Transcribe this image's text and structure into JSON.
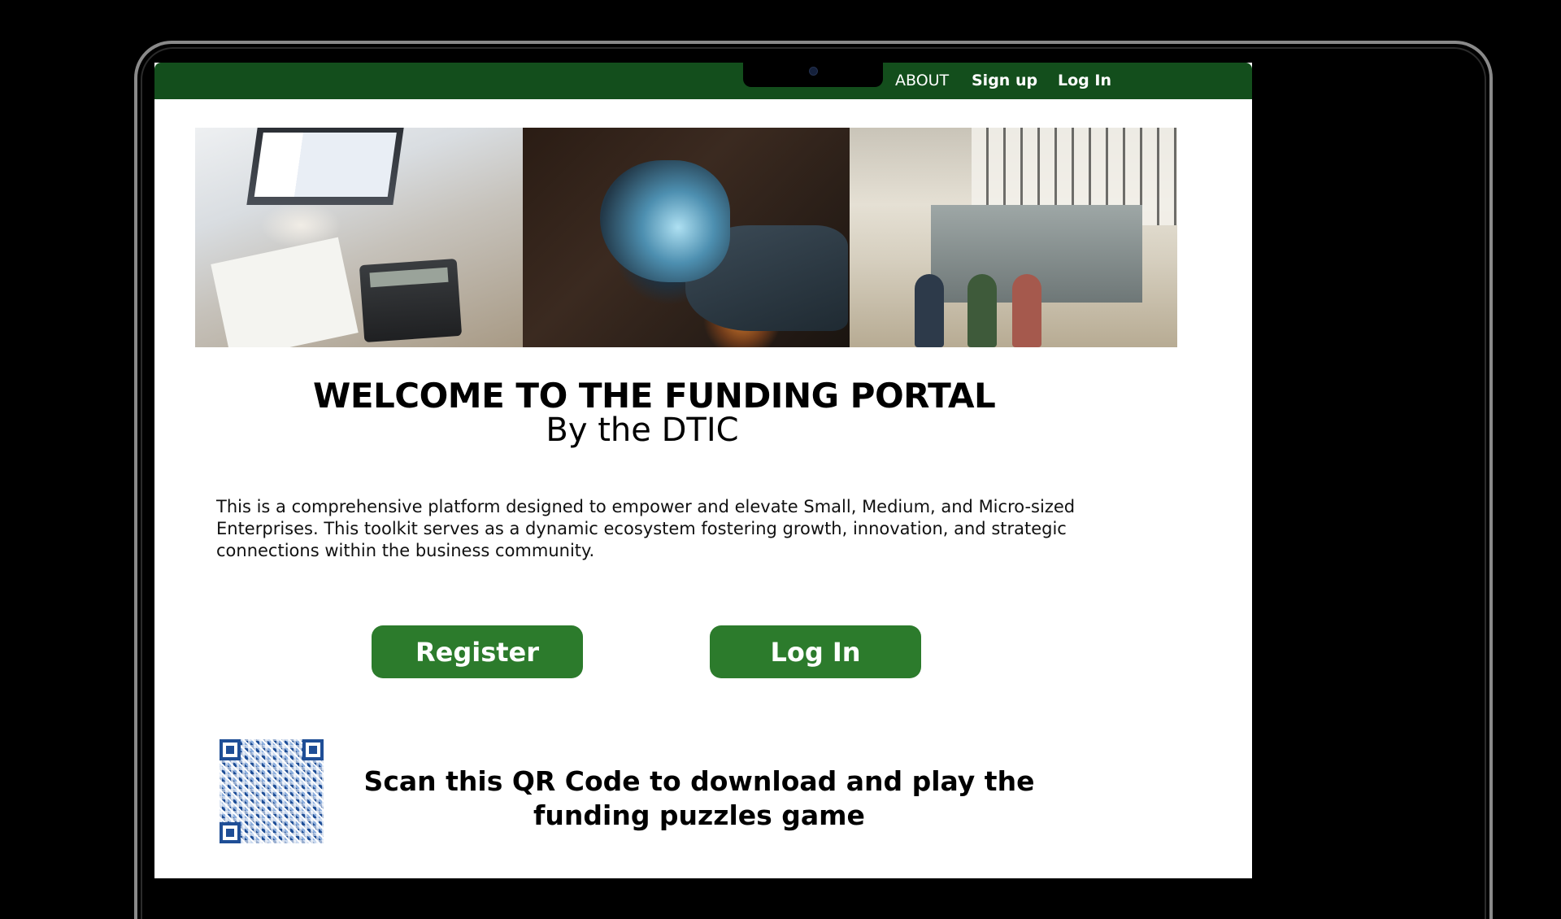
{
  "nav": {
    "about": "ABOUT",
    "signup": "Sign up",
    "login": "Log In"
  },
  "hero": {
    "title": "WELCOME TO THE FUNDING PORTAL",
    "subtitle": "By the DTIC"
  },
  "description": "This is a comprehensive platform designed to empower and elevate Small, Medium, and Micro-sized Enterprises. This toolkit serves as a dynamic ecosystem fostering growth, innovation, and strategic connections within the business community.",
  "buttons": {
    "register": "Register",
    "login": "Log In"
  },
  "qr": {
    "text": "Scan this QR Code to download and play the funding puzzles game"
  },
  "colors": {
    "navbar": "#134e1c",
    "button": "#2c7b2c",
    "qr": "#1f4e96"
  },
  "icons": {
    "camera": "camera-icon",
    "qr": "qr-code-icon"
  }
}
